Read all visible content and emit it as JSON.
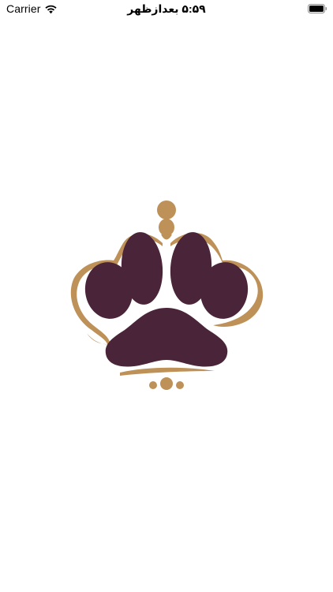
{
  "status_bar": {
    "carrier": "Carrier",
    "time": "۵:۵۹ بعدازظهر",
    "wifi_icon": "wifi-icon",
    "battery_icon": "battery-full-icon"
  },
  "splash": {
    "logo_icon": "crowned-paw-logo",
    "colors": {
      "paw": "#4a2438",
      "crown": "#bd9157",
      "background": "#ffffff"
    }
  }
}
